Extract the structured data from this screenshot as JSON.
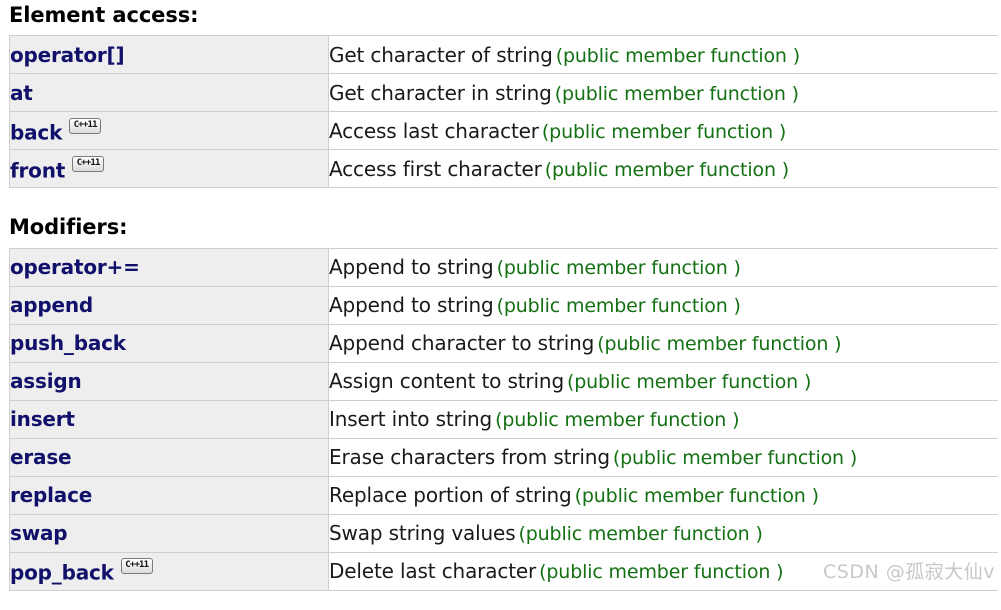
{
  "sections": [
    {
      "heading": "Element access",
      "heading_colon": ":",
      "rows": [
        {
          "name": "operator[]",
          "badge": "",
          "desc": "Get character of string",
          "note": "(public member function )"
        },
        {
          "name": "at",
          "badge": "",
          "desc": "Get character in string",
          "note": "(public member function )"
        },
        {
          "name": "back",
          "badge": "C++11",
          "desc": "Access last character",
          "note": "(public member function )"
        },
        {
          "name": "front",
          "badge": "C++11",
          "desc": "Access first character",
          "note": "(public member function )"
        }
      ]
    },
    {
      "heading": "Modifiers",
      "heading_colon": ":",
      "rows": [
        {
          "name": "operator+=",
          "badge": "",
          "desc": "Append to string",
          "note": "(public member function )"
        },
        {
          "name": "append",
          "badge": "",
          "desc": "Append to string",
          "note": "(public member function )"
        },
        {
          "name": "push_back",
          "badge": "",
          "desc": "Append character to string",
          "note": "(public member function )"
        },
        {
          "name": "assign",
          "badge": "",
          "desc": "Assign content to string",
          "note": "(public member function )"
        },
        {
          "name": "insert",
          "badge": "",
          "desc": "Insert into string",
          "note": "(public member function )"
        },
        {
          "name": "erase",
          "badge": "",
          "desc": "Erase characters from string",
          "note": "(public member function )"
        },
        {
          "name": "replace",
          "badge": "",
          "desc": "Replace portion of string",
          "note": "(public member function )"
        },
        {
          "name": "swap",
          "badge": "",
          "desc": "Swap string values",
          "note": "(public member function )"
        },
        {
          "name": "pop_back",
          "badge": "C++11",
          "desc": "Delete last character",
          "note": "(public member function )"
        }
      ]
    }
  ],
  "watermark": "CSDN @孤寂大仙v",
  "colors": {
    "member_link": "#11116b",
    "note_green": "#137013",
    "name_cell_bg": "#eeeeee",
    "border": "#cfcfcf",
    "watermark": "#c8c8c8"
  }
}
